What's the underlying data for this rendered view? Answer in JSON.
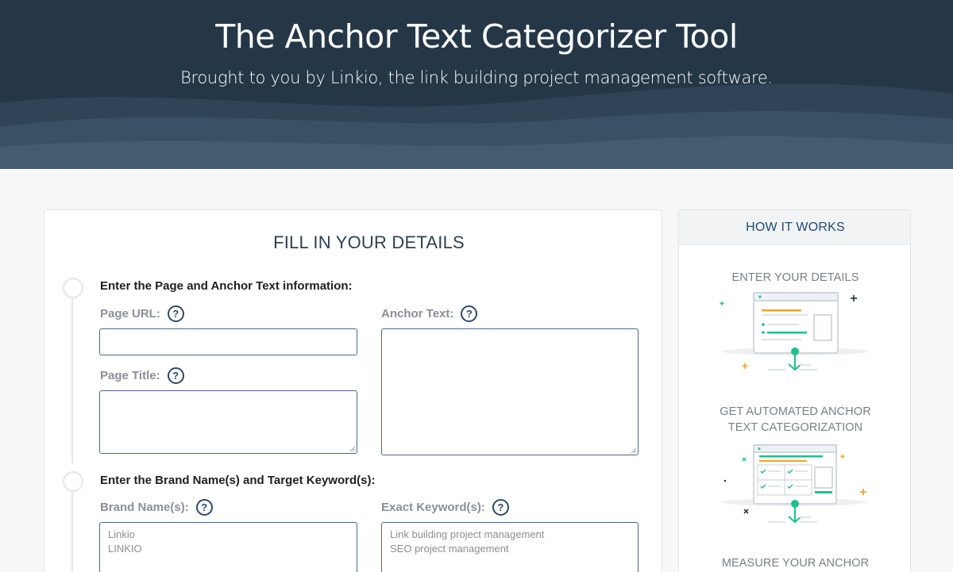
{
  "hero": {
    "title": "The Anchor Text Categorizer Tool",
    "subtitle": "Brought to you by Linkio, the link building project management software."
  },
  "form": {
    "heading": "FILL IN YOUR DETAILS",
    "step1": {
      "label": "Enter the Page and Anchor Text information:",
      "page_url_label": "Page URL:",
      "page_url_value": "",
      "anchor_text_label": "Anchor Text:",
      "anchor_text_value": "",
      "page_title_label": "Page Title:",
      "page_title_value": ""
    },
    "step2": {
      "label": "Enter the Brand Name(s) and Target Keyword(s):",
      "brand_label": "Brand Name(s):",
      "brand_placeholder": "Linkio\nLINKIO",
      "exact_label": "Exact Keyword(s):",
      "exact_placeholder": "Link building project management\nSEO project management"
    },
    "help_glyph": "?"
  },
  "how_it_works": {
    "title": "HOW IT WORKS",
    "steps": [
      {
        "label": "ENTER YOUR DETAILS",
        "illustration": "form-entry-illustration"
      },
      {
        "label": "GET AUTOMATED ANCHOR TEXT CATEGORIZATION",
        "illustration": "categorization-illustration"
      },
      {
        "label": "MEASURE YOUR ANCHOR"
      }
    ]
  },
  "colors": {
    "hero_bg": "#253747",
    "accent_teal": "#1fbf8f",
    "accent_orange": "#f5a623",
    "link_blue": "#1f4c75"
  }
}
